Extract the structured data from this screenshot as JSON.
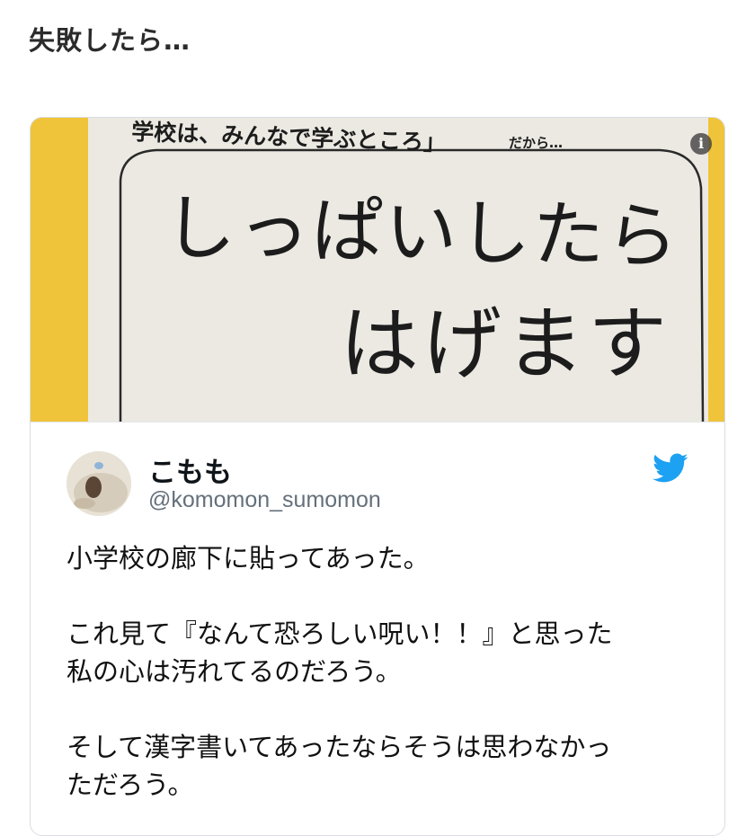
{
  "article": {
    "heading": "失敗したら…"
  },
  "embed": {
    "image": {
      "sign_top_text": "学校は、みんなで学ぶところ」",
      "sign_small_text": "だから…",
      "sign_line1": "しっぱいしたら",
      "sign_line2": "はげます",
      "info_icon": "info-icon",
      "colors": {
        "frame": "#f0c43a",
        "paper": "#ece9e3",
        "ink": "#1c1c1c"
      }
    },
    "tweet": {
      "user_name": "こもも",
      "user_handle": "@komomon_sumomon",
      "platform_icon": "twitter-bird-icon",
      "brand_color": "#1da1f2",
      "paragraphs": [
        "小学校の廊下に貼ってあった。",
        "これ見て『なんて恐ろしい呪い！！』と思った\n私の心は汚れてるのだろう。",
        "そして漢字書いてあったならそうは思わなかっ\nただろう。"
      ]
    }
  }
}
